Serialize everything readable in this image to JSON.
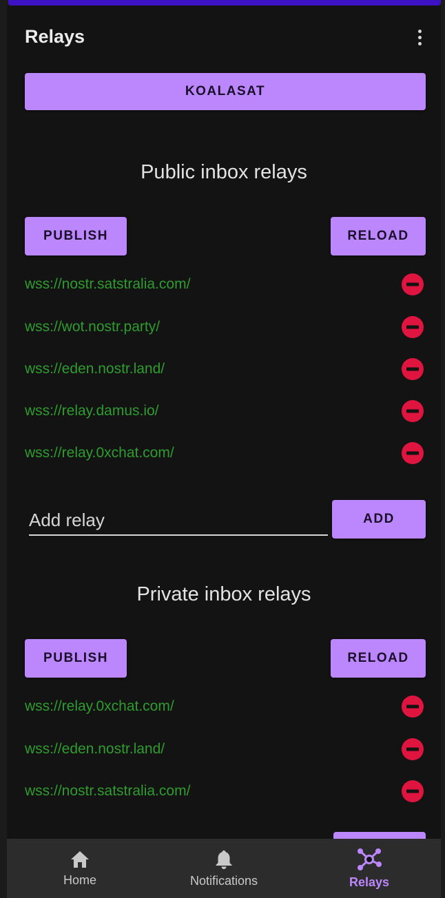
{
  "topbar": {
    "title": "Relays",
    "menu_icon": "more-vert-icon"
  },
  "account_button": {
    "label": "KOALASAT"
  },
  "public": {
    "title": "Public inbox relays",
    "publish_label": "PUBLISH",
    "reload_label": "RELOAD",
    "relays": [
      "wss://nostr.satstralia.com/",
      "wss://wot.nostr.party/",
      "wss://eden.nostr.land/",
      "wss://relay.damus.io/",
      "wss://relay.0xchat.com/"
    ],
    "add_placeholder": "Add relay",
    "add_label": "ADD"
  },
  "private": {
    "title": "Private inbox relays",
    "publish_label": "PUBLISH",
    "reload_label": "RELOAD",
    "relays": [
      "wss://relay.0xchat.com/",
      "wss://eden.nostr.land/",
      "wss://nostr.satstralia.com/"
    ]
  },
  "bottom_nav": {
    "items": [
      {
        "label": "Home",
        "icon": "home-icon",
        "active": false
      },
      {
        "label": "Notifications",
        "icon": "bell-icon",
        "active": false
      },
      {
        "label": "Relays",
        "icon": "hub-icon",
        "active": true
      }
    ]
  },
  "colors": {
    "accent": "#bc86fc",
    "relay_text": "#2e9c2e",
    "remove": "#e0153f",
    "background": "#131313"
  }
}
